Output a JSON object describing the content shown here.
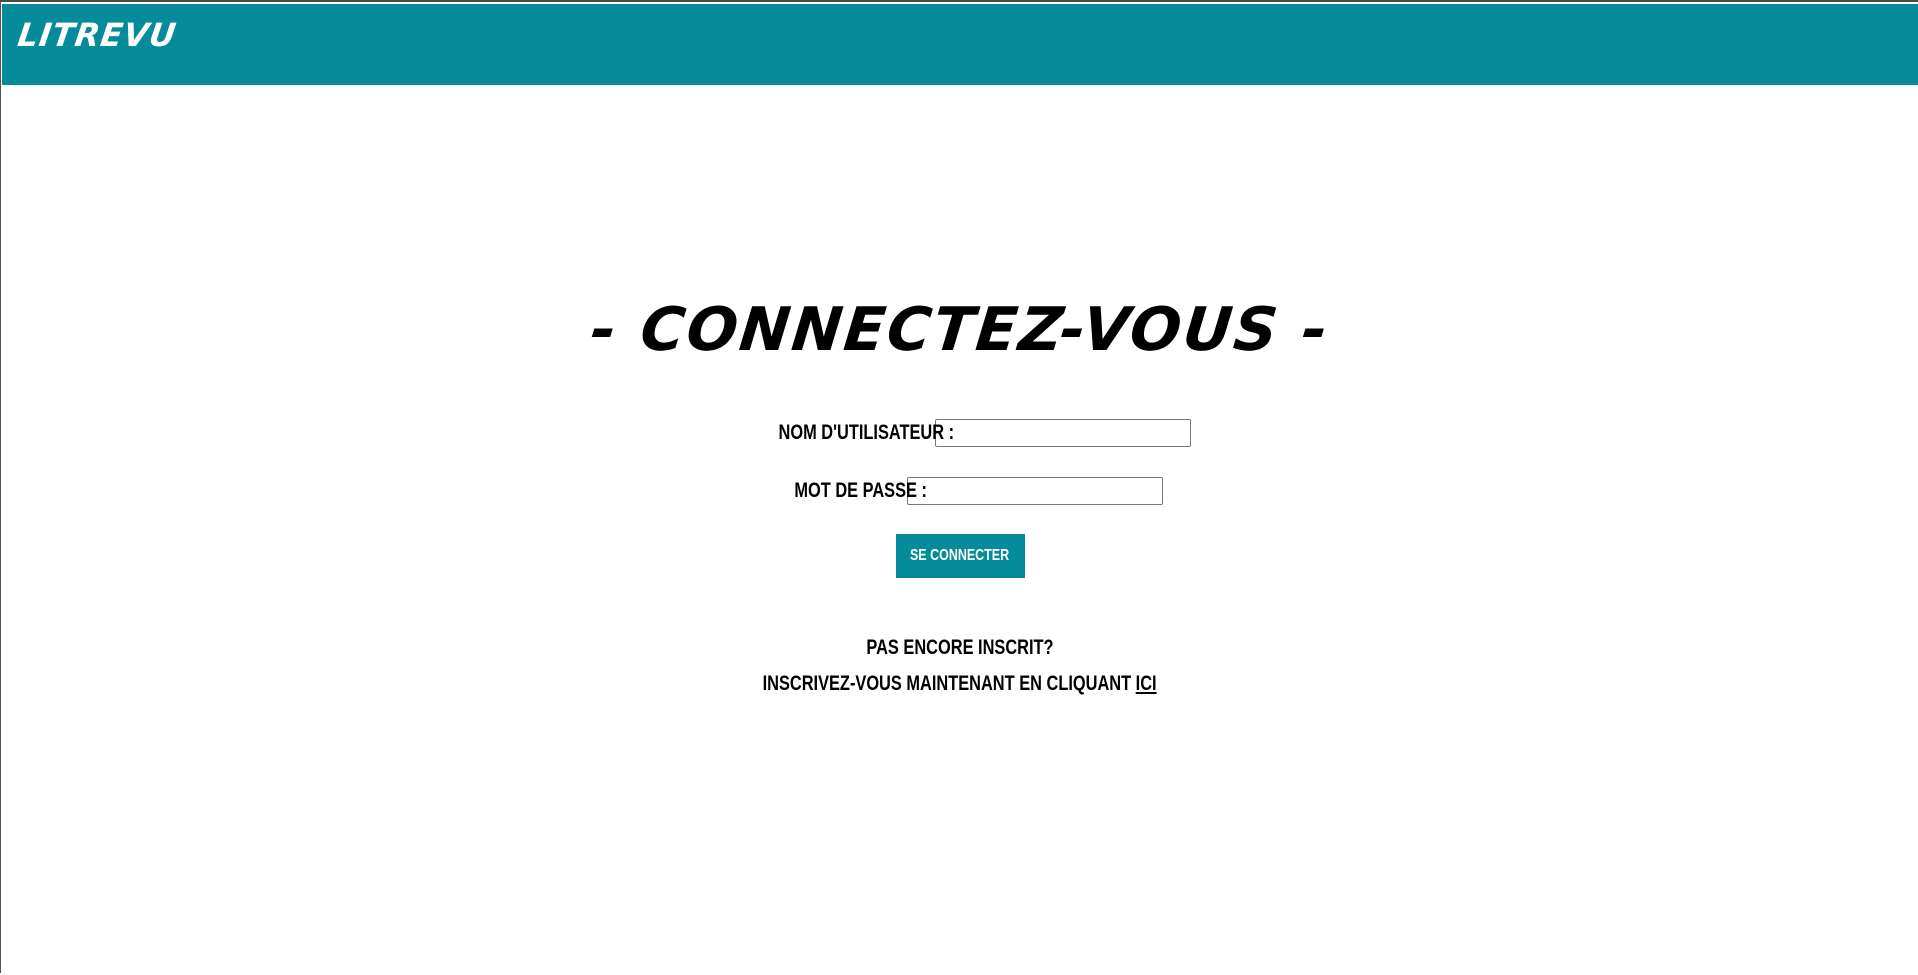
{
  "header": {
    "logo": "LITREVU"
  },
  "login": {
    "title": "- CONNECTEZ-VOUS -",
    "username_label": "NOM D'UTILISATEUR :",
    "username_value": "",
    "password_label": "MOT DE PASSE :",
    "password_value": "",
    "submit_label": "SE CONNECTER"
  },
  "signup": {
    "question": "PAS ENCORE INSCRIT?",
    "prompt": "INSCRIVEZ-VOUS MAINTENANT EN CLIQUANT",
    "link_label": "ICI"
  },
  "colors": {
    "accent": "#058b99",
    "text": "#000000",
    "background": "#ffffff"
  }
}
